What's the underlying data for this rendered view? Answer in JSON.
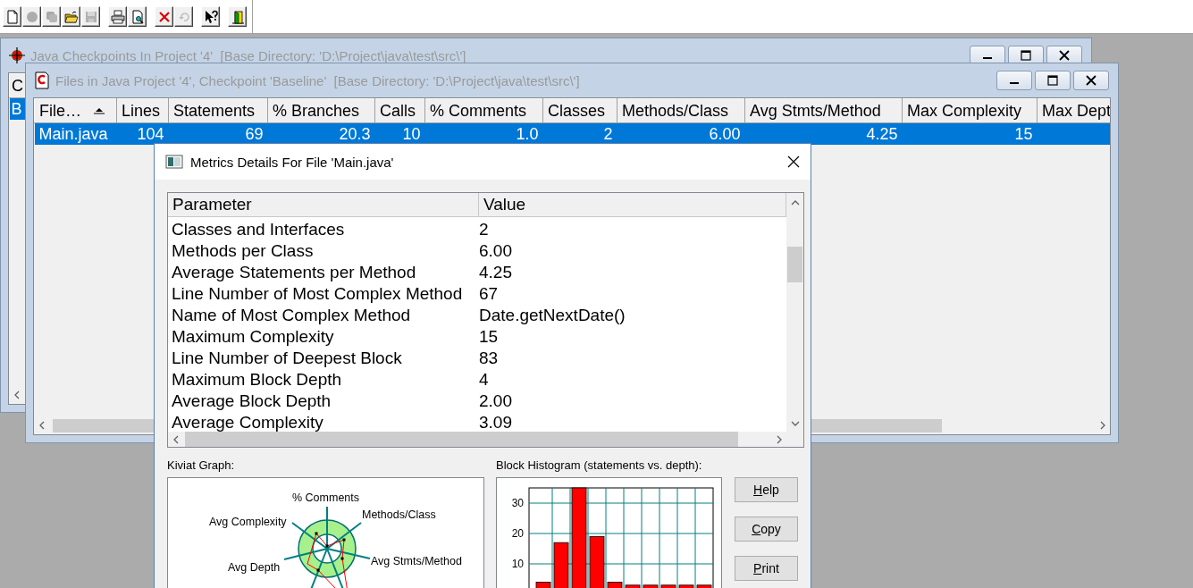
{
  "toolbar": {
    "groups": [
      {
        "buttons": [
          {
            "kind": "new",
            "disabled": false
          },
          {
            "kind": "circle",
            "disabled": true
          },
          {
            "kind": "stack",
            "disabled": true
          },
          {
            "kind": "open",
            "disabled": false
          },
          {
            "kind": "save",
            "disabled": true
          }
        ]
      },
      {
        "buttons": [
          {
            "kind": "print",
            "disabled": false
          },
          {
            "kind": "preview",
            "disabled": false
          }
        ]
      },
      {
        "buttons": [
          {
            "kind": "delete",
            "disabled": false
          },
          {
            "kind": "undo",
            "disabled": true
          }
        ]
      },
      {
        "buttons": [
          {
            "kind": "help",
            "disabled": false
          }
        ]
      },
      {
        "buttons": [
          {
            "kind": "exit",
            "disabled": false
          }
        ]
      }
    ]
  },
  "windows": [
    {
      "kind": "list",
      "active": false,
      "title": "Java Checkpoints In Project '4'  [Base Directory: 'D:\\Project\\java\\test\\src\\']",
      "table": {
        "columns": [
          {
            "label": "C"
          }
        ],
        "rows": [
          {
            "cells": [
              "B"
            ],
            "selected": true
          }
        ]
      }
    },
    {
      "kind": "list",
      "active": false,
      "title": "Files in Java Project '4', Checkpoint 'Baseline'  [Base Directory: 'D:\\Project\\java\\test\\src\\']",
      "table": {
        "columns": [
          {
            "label": "File…",
            "sorted": true
          },
          {
            "label": "Lines",
            "sorted": false
          },
          {
            "label": "Statements",
            "sorted": false
          },
          {
            "label": "% Branches",
            "sorted": false
          },
          {
            "label": "Calls",
            "sorted": false
          },
          {
            "label": "% Comments",
            "sorted": false
          },
          {
            "label": "Classes",
            "sorted": false
          },
          {
            "label": "Methods/Class",
            "sorted": false
          },
          {
            "label": "Avg Stmts/Method",
            "sorted": false
          },
          {
            "label": "Max Complexity",
            "sorted": false
          },
          {
            "label": "Max Dept",
            "sorted": false
          }
        ],
        "rows": [
          {
            "cells": [
              "Main.java",
              "104",
              "69",
              "20.3",
              "10",
              "1.0",
              "2",
              "6.00",
              "4.25",
              "15"
            ],
            "selected": true
          }
        ]
      }
    },
    {
      "kind": "dialog",
      "active": true,
      "title": "Metrics Details For File 'Main.java'",
      "details": {
        "columns": [
          "Parameter",
          "Value"
        ],
        "rows": [
          {
            "parameter": "Classes and Interfaces",
            "value": "2"
          },
          {
            "parameter": "Methods per Class",
            "value": "6.00"
          },
          {
            "parameter": "Average Statements per Method",
            "value": "4.25"
          },
          {
            "parameter": "Line Number of Most Complex Method",
            "value": "67"
          },
          {
            "parameter": "Name of Most Complex Method",
            "value": "Date.getNextDate()"
          },
          {
            "parameter": "Maximum Complexity",
            "value": "15"
          },
          {
            "parameter": "Line Number of Deepest Block",
            "value": "83"
          },
          {
            "parameter": "Maximum Block Depth",
            "value": "4"
          },
          {
            "parameter": "Average Block Depth",
            "value": "2.00"
          },
          {
            "parameter": "Average Complexity",
            "value": "3.09"
          }
        ]
      },
      "kiviat": {
        "label": "Kiviat Graph:",
        "axes": [
          "% Comments",
          "Methods/Class",
          "Avg Stmts/Method",
          "Avg Depth",
          "Avg Complexity"
        ]
      },
      "histogram": {
        "label": "Block Histogram (statements vs. depth):",
        "chart_data": {
          "type": "bar",
          "values": [
            4,
            17,
            35,
            19,
            4,
            3,
            3,
            3,
            3,
            3
          ],
          "ylim": [
            0,
            35
          ],
          "yticks": [
            10,
            20,
            30
          ],
          "grid": true
        }
      },
      "buttons": [
        "Help",
        "Copy",
        "Print"
      ]
    }
  ]
}
